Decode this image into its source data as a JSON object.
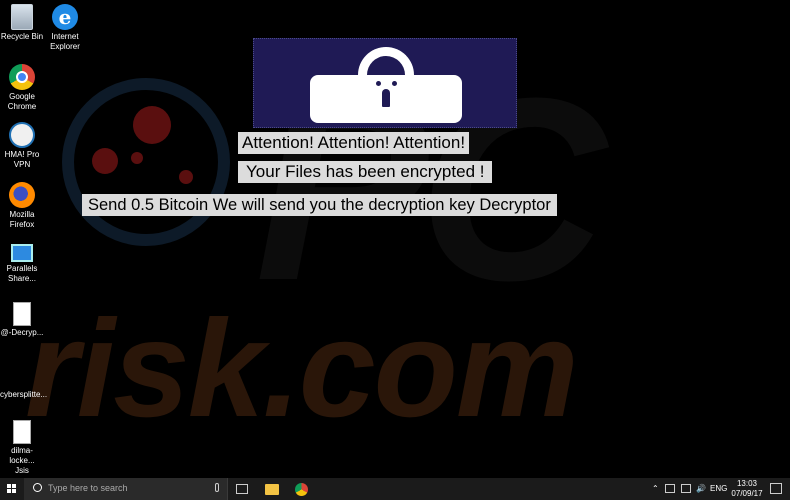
{
  "desktop_icons": [
    {
      "name": "recycle-bin",
      "label": "Recycle Bin"
    },
    {
      "name": "internet-explorer",
      "label": "Internet Explorer"
    },
    {
      "name": "google-chrome",
      "label": "Google Chrome"
    },
    {
      "name": "hma-pro-vpn",
      "label": "HMA! Pro VPN"
    },
    {
      "name": "mozilla-firefox",
      "label": "Mozilla Firefox"
    },
    {
      "name": "parallels-share",
      "label": "Parallels Share..."
    },
    {
      "name": "decrypt-file",
      "label": "@-Decryp..."
    },
    {
      "name": "cybersplitter-file",
      "label": "cybersplitte..."
    },
    {
      "name": "dilma-locker-file",
      "label": "dilma-locke... Jsis"
    }
  ],
  "ransom_note": {
    "line1": "Attention! Attention! Attention!",
    "line2": "Your Files has been encrypted !",
    "line3": "Send 0.5 Bitcoin We will send you the decryption key  Decryptor"
  },
  "watermark": {
    "pc": "PC",
    "risk": "risk.com"
  },
  "taskbar": {
    "search_placeholder": "Type here to search",
    "language": "ENG",
    "time": "13:03",
    "date": "07/09/17"
  },
  "colors": {
    "desktop_bg": "#000000",
    "lock_panel_bg": "#1f1a55",
    "message_bg": "#dcdcdc",
    "taskbar_bg": "#1b1b1b"
  }
}
